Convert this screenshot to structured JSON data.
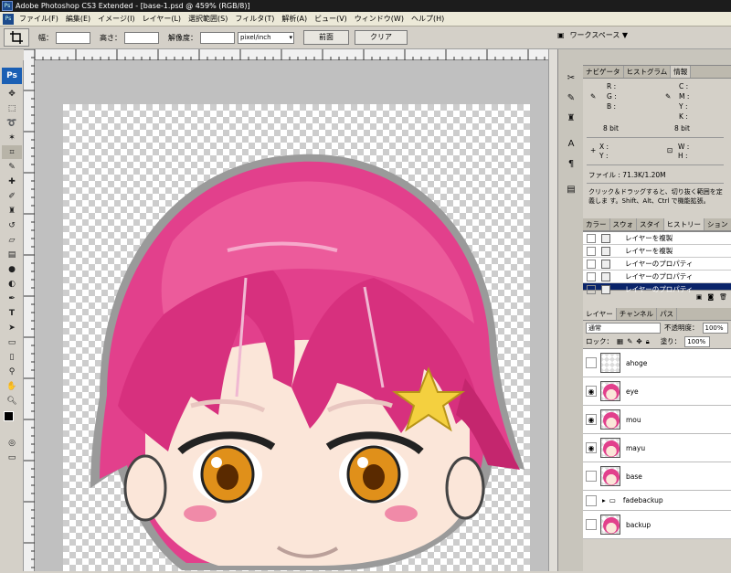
{
  "window": {
    "title": "Adobe Photoshop CS3 Extended - [base-1.psd @ 459% (RGB/8)]",
    "app_icon": "Ps"
  },
  "menu": {
    "items": [
      "ファイル(F)",
      "編集(E)",
      "イメージ(I)",
      "レイヤー(L)",
      "選択範囲(S)",
      "フィルタ(T)",
      "解析(A)",
      "ビュー(V)",
      "ウィンドウ(W)",
      "ヘルプ(H)"
    ]
  },
  "options": {
    "width_label": "幅：",
    "height_label": "高さ：",
    "resolution_label": "解像度：",
    "unit_value": "pixel/inch",
    "front_button": "前面",
    "clear_button": "クリア",
    "workspace_label": "ワークスペース ▼"
  },
  "toolbox": {
    "logo": "Ps",
    "tools": [
      "move-tool",
      "marquee-tool",
      "lasso-tool",
      "magic-wand-tool",
      "crop-tool",
      "eyedropper-tool",
      "healing-brush-tool",
      "brush-tool",
      "clone-stamp-tool",
      "history-brush-tool",
      "eraser-tool",
      "gradient-tool",
      "blur-tool",
      "dodge-tool",
      "pen-tool",
      "type-tool",
      "path-select-tool",
      "shape-tool",
      "notes-tool",
      "eyedropper2-tool",
      "hand-tool",
      "zoom-tool"
    ]
  },
  "info_panel": {
    "tabs": [
      "ナビゲータ",
      "ヒストグラム",
      "情報"
    ],
    "rgb_labels": [
      "R :",
      "G :",
      "B :"
    ],
    "cmyk_labels": [
      "C :",
      "M :",
      "Y :",
      "K :"
    ],
    "bit_left": "8 bit",
    "bit_right": "8 bit",
    "xy_labels": [
      "X :",
      "Y :"
    ],
    "wh_labels": [
      "W :",
      "H :"
    ],
    "file_info": "ファイル : 71.3K/1.20M",
    "help_text": "クリック＆ドラッグすると、切り抜く範囲を定義しま す。Shift、Alt、Ctrl で機能拡張。"
  },
  "history_panel": {
    "tabs": [
      "カラー",
      "スウォ",
      "スタイ",
      "ヒストリー",
      "ション"
    ],
    "items": [
      {
        "label": "レイヤーを複製",
        "selected": false
      },
      {
        "label": "レイヤーを複製",
        "selected": false
      },
      {
        "label": "レイヤーのプロパティ",
        "selected": false
      },
      {
        "label": "レイヤーのプロパティ",
        "selected": false
      },
      {
        "label": "レイヤーのプロパティ",
        "selected": true
      }
    ]
  },
  "layers_panel": {
    "tabs": [
      "レイヤー",
      "チャンネル",
      "パス"
    ],
    "blend_mode": "通常",
    "opacity_label": "不透明度：",
    "opacity_value": "100%",
    "lock_label": "ロック：",
    "fill_label": "塗り：",
    "fill_value": "100%",
    "layers": [
      {
        "name": "ahoge",
        "visible": false
      },
      {
        "name": "eye",
        "visible": true
      },
      {
        "name": "mou",
        "visible": true
      },
      {
        "name": "mayu",
        "visible": true
      },
      {
        "name": "base",
        "visible": false
      },
      {
        "name": "fadebackup",
        "visible": false,
        "is_group": true
      },
      {
        "name": "backup",
        "visible": false
      }
    ]
  },
  "colors": {
    "hair": "#e2408c",
    "hair_dark": "#c4266e",
    "skin": "#fbe6d9",
    "eye": "#e0901a",
    "star": "#f4d03f",
    "selection": "#0a246a"
  }
}
